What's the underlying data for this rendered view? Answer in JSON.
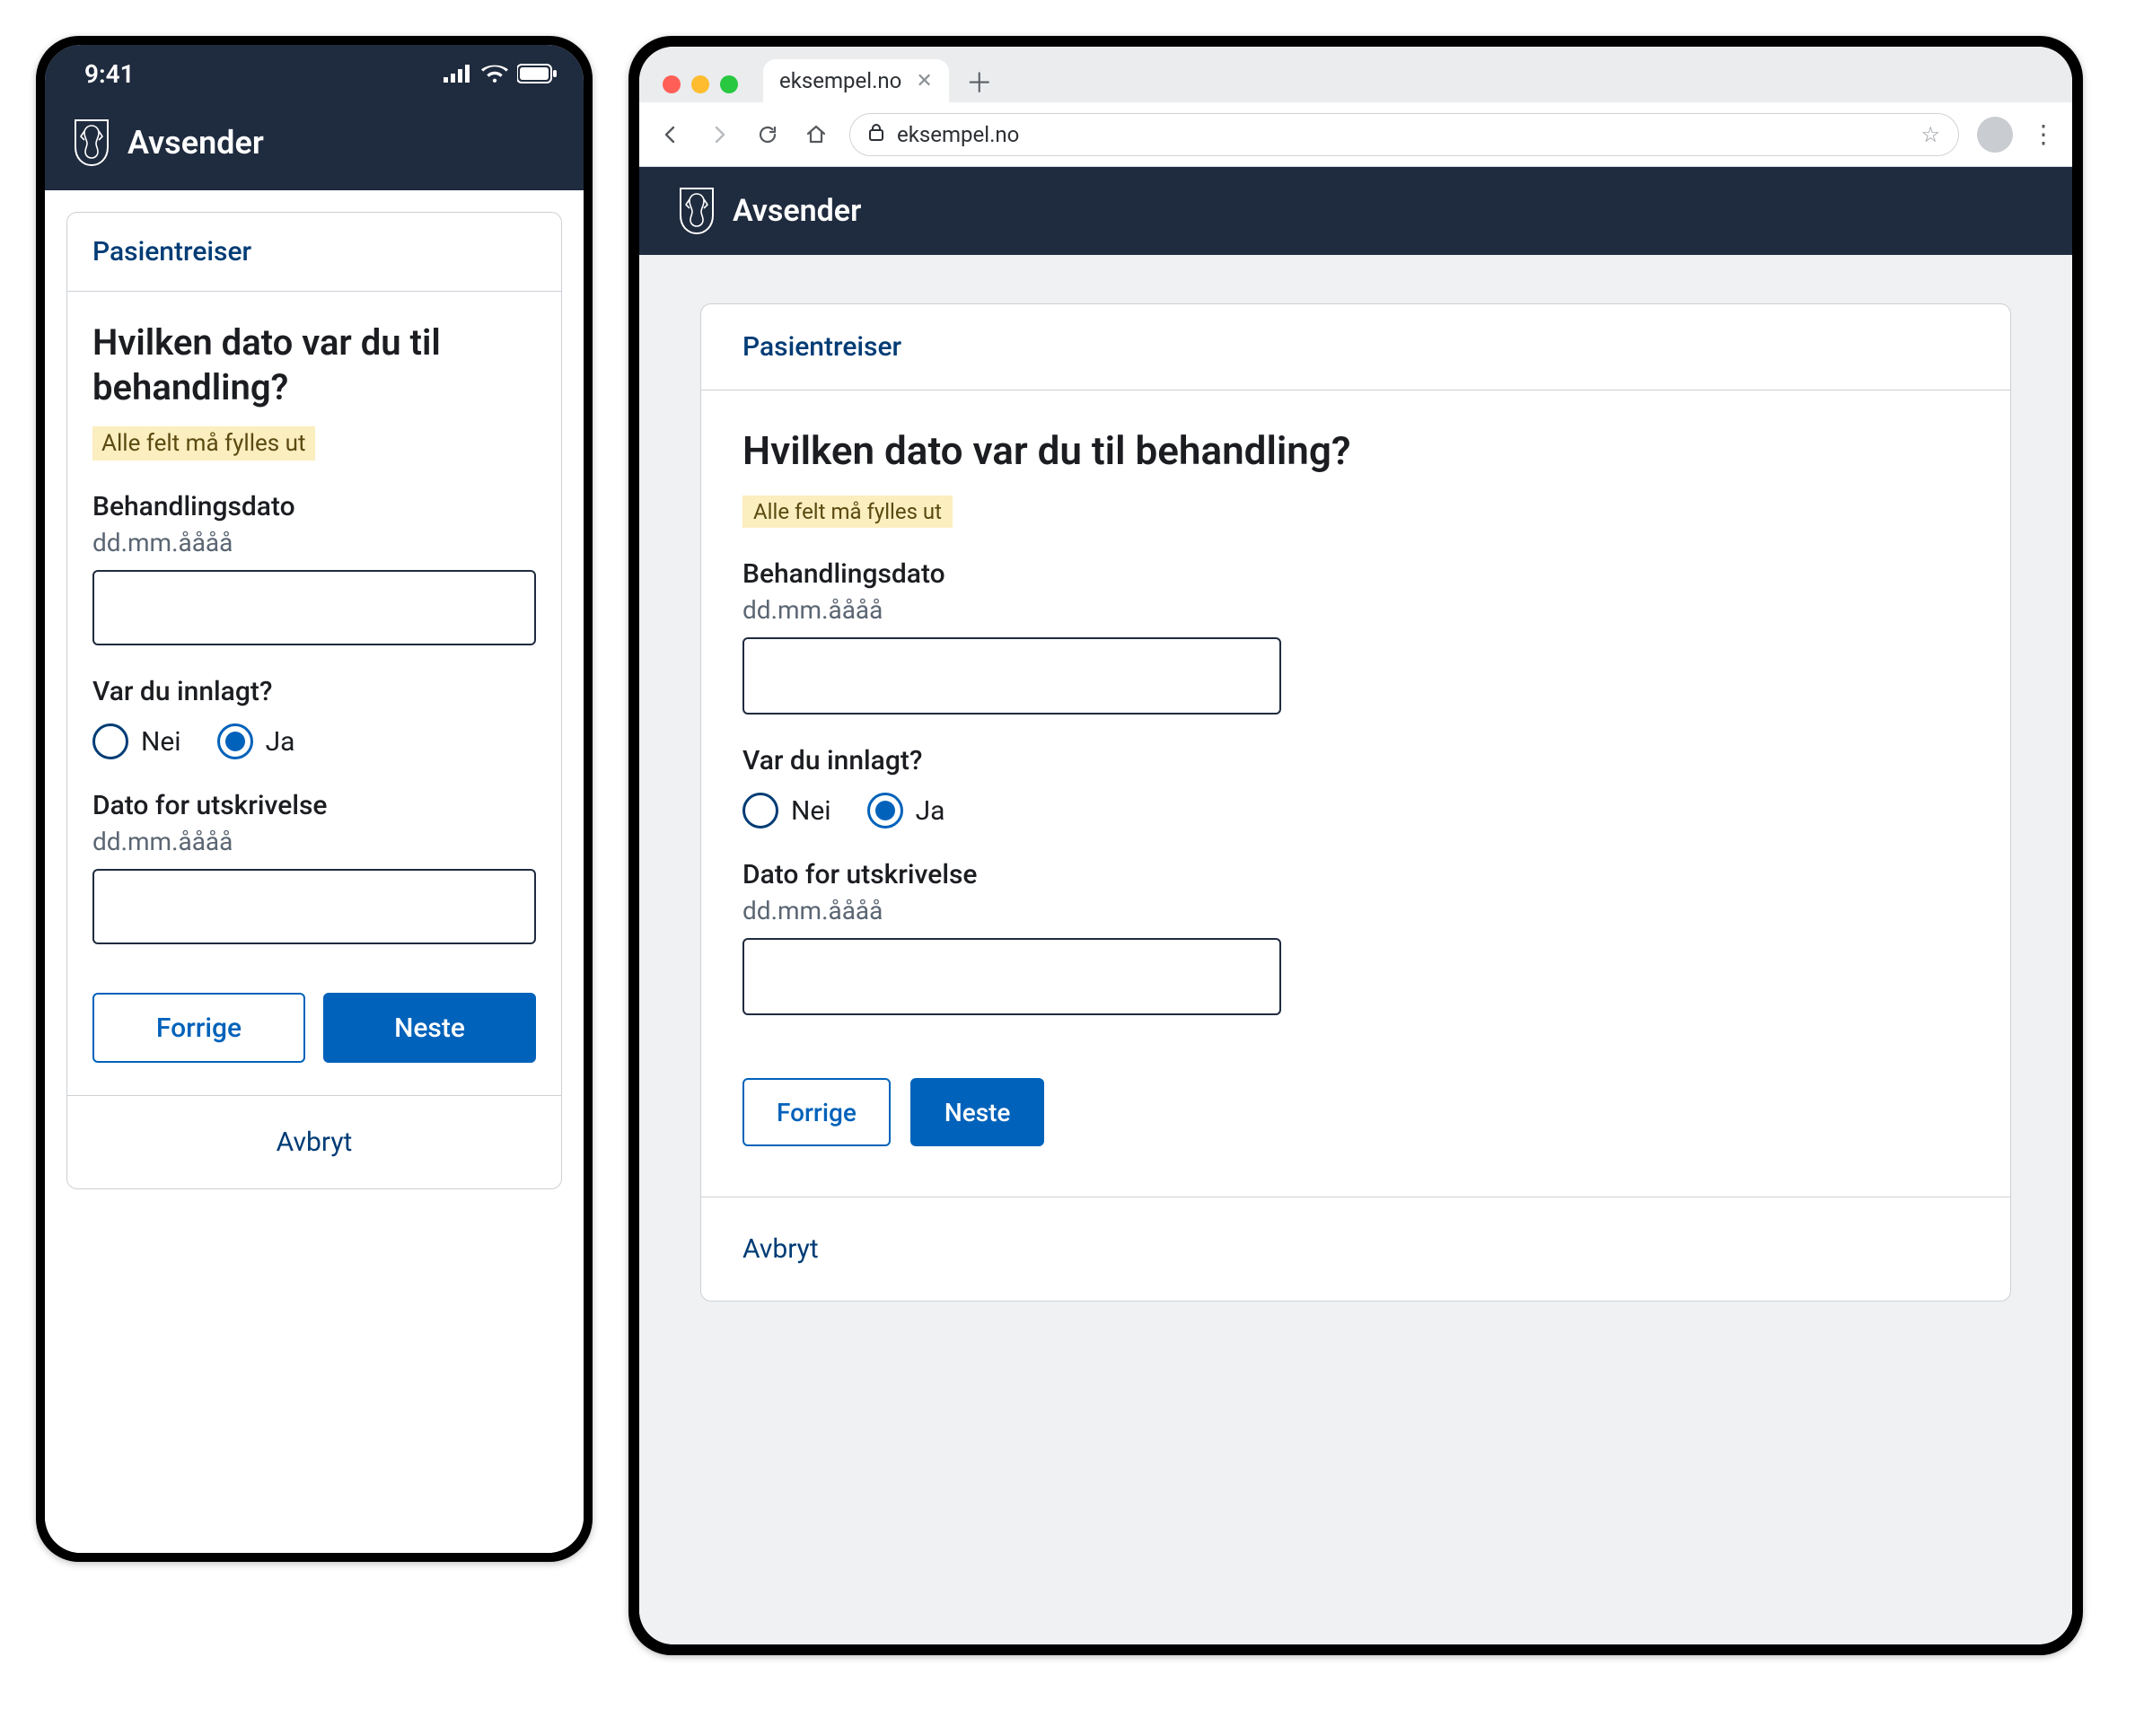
{
  "phone": {
    "status_time": "9:41"
  },
  "app": {
    "brand": "Avsender"
  },
  "browser": {
    "tab_title": "eksempel.no",
    "url_display": "eksempel.no"
  },
  "form": {
    "context_title": "Pasientreiser",
    "heading": "Hvilken dato var du til behandling?",
    "required_notice": "Alle felt må fylles ut",
    "fields": {
      "treatment_date": {
        "label": "Behandlingsdato",
        "hint": "dd.mm.åååå",
        "value": ""
      },
      "admitted": {
        "label": "Var du innlagt?",
        "options": {
          "no": "Nei",
          "yes": "Ja"
        },
        "selected": "yes"
      },
      "discharge_date": {
        "label": "Dato for utskrivelse",
        "hint": "dd.mm.åååå",
        "value": ""
      }
    },
    "buttons": {
      "previous": "Forrige",
      "next": "Neste",
      "cancel": "Avbryt"
    }
  },
  "colors": {
    "brand_navy": "#1F2B3E",
    "primary_blue": "#0062BA",
    "tag_bg": "#FBEEBF"
  }
}
